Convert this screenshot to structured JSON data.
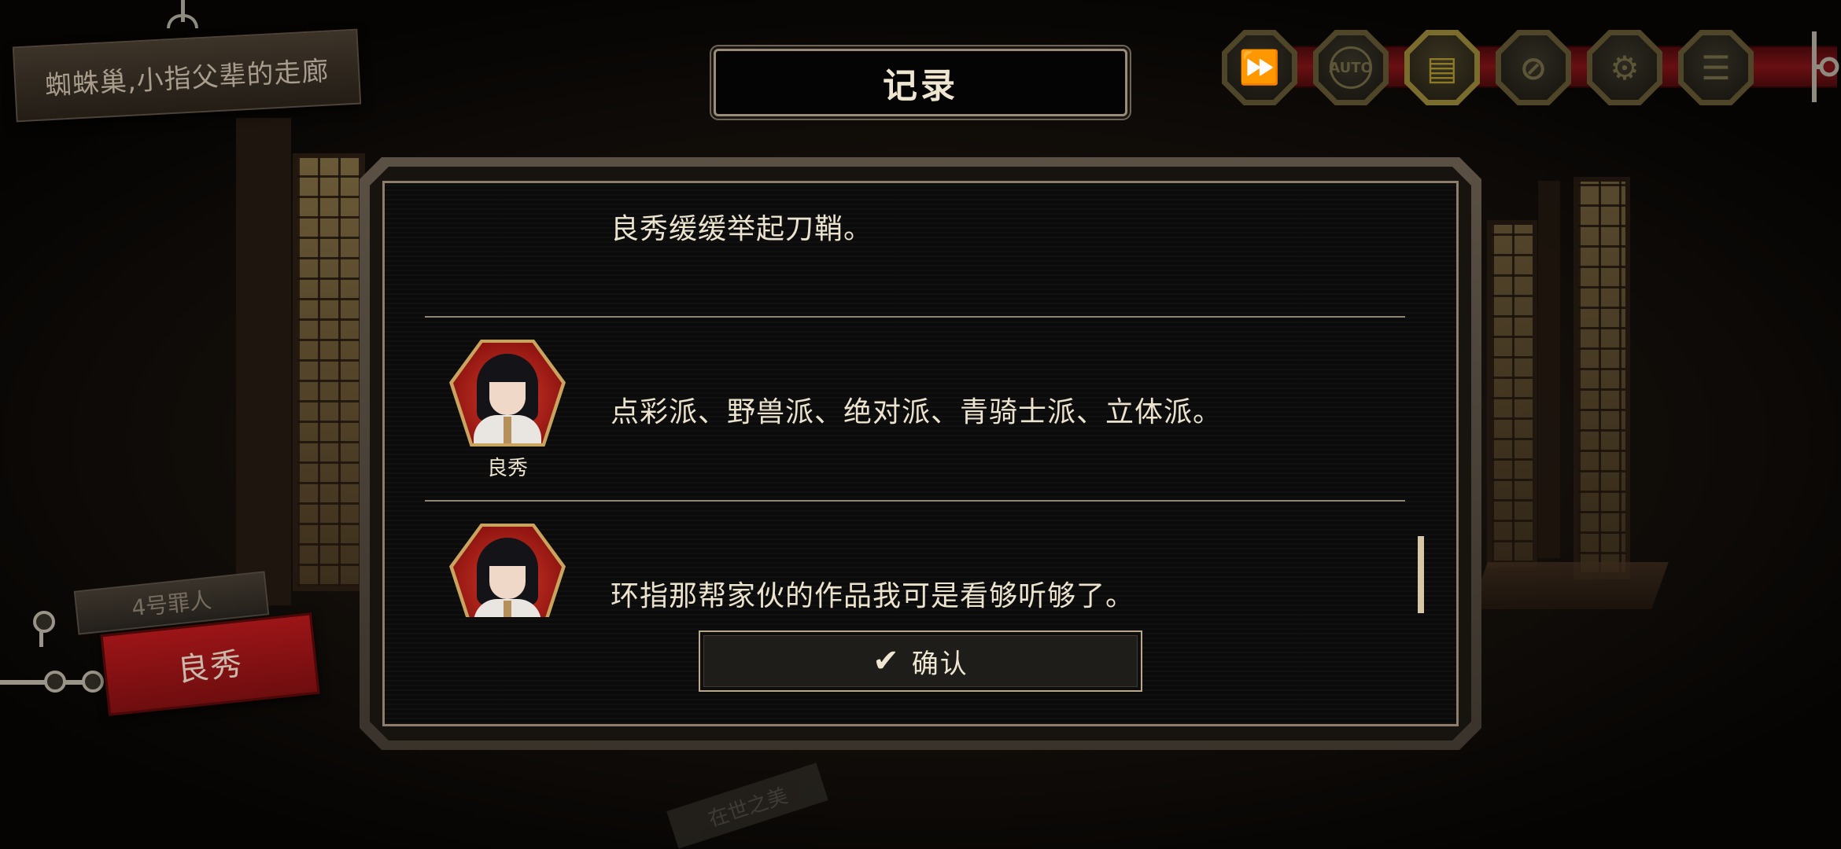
{
  "location": {
    "name": "蜘蛛巢,小指父辈的走廊"
  },
  "toolbar": {
    "buttons": [
      {
        "name": "fast-forward",
        "icon": "fast-forward-icon",
        "glyph": "⏩"
      },
      {
        "name": "auto",
        "icon": "auto-play-icon",
        "glyph": "AUTO"
      },
      {
        "name": "log",
        "icon": "log-icon",
        "glyph": "▤"
      },
      {
        "name": "hide-ui",
        "icon": "hide-ui-icon",
        "glyph": "⊘"
      },
      {
        "name": "settings",
        "icon": "gear-icon",
        "glyph": "⚙"
      },
      {
        "name": "menu",
        "icon": "menu-icon",
        "glyph": "☰"
      }
    ],
    "active": "log",
    "accent_color": "#7a6c2c"
  },
  "dialog": {
    "title": "记录",
    "entries": [
      {
        "speaker": "",
        "text": "良秀缓缓举起刀鞘。"
      },
      {
        "speaker": "良秀",
        "text": "点彩派、野兽派、绝对派、青骑士派、立体派。"
      },
      {
        "speaker": "",
        "text": "环指那帮家伙的作品我可是看够听够了。"
      }
    ],
    "confirm_label": "确认",
    "confirm_icon": "check-icon"
  },
  "sinner": {
    "number_label": "4号罪人",
    "name": "良秀",
    "plate_color": "#9c1517"
  },
  "background": {
    "floor_sign": "在世之美"
  }
}
